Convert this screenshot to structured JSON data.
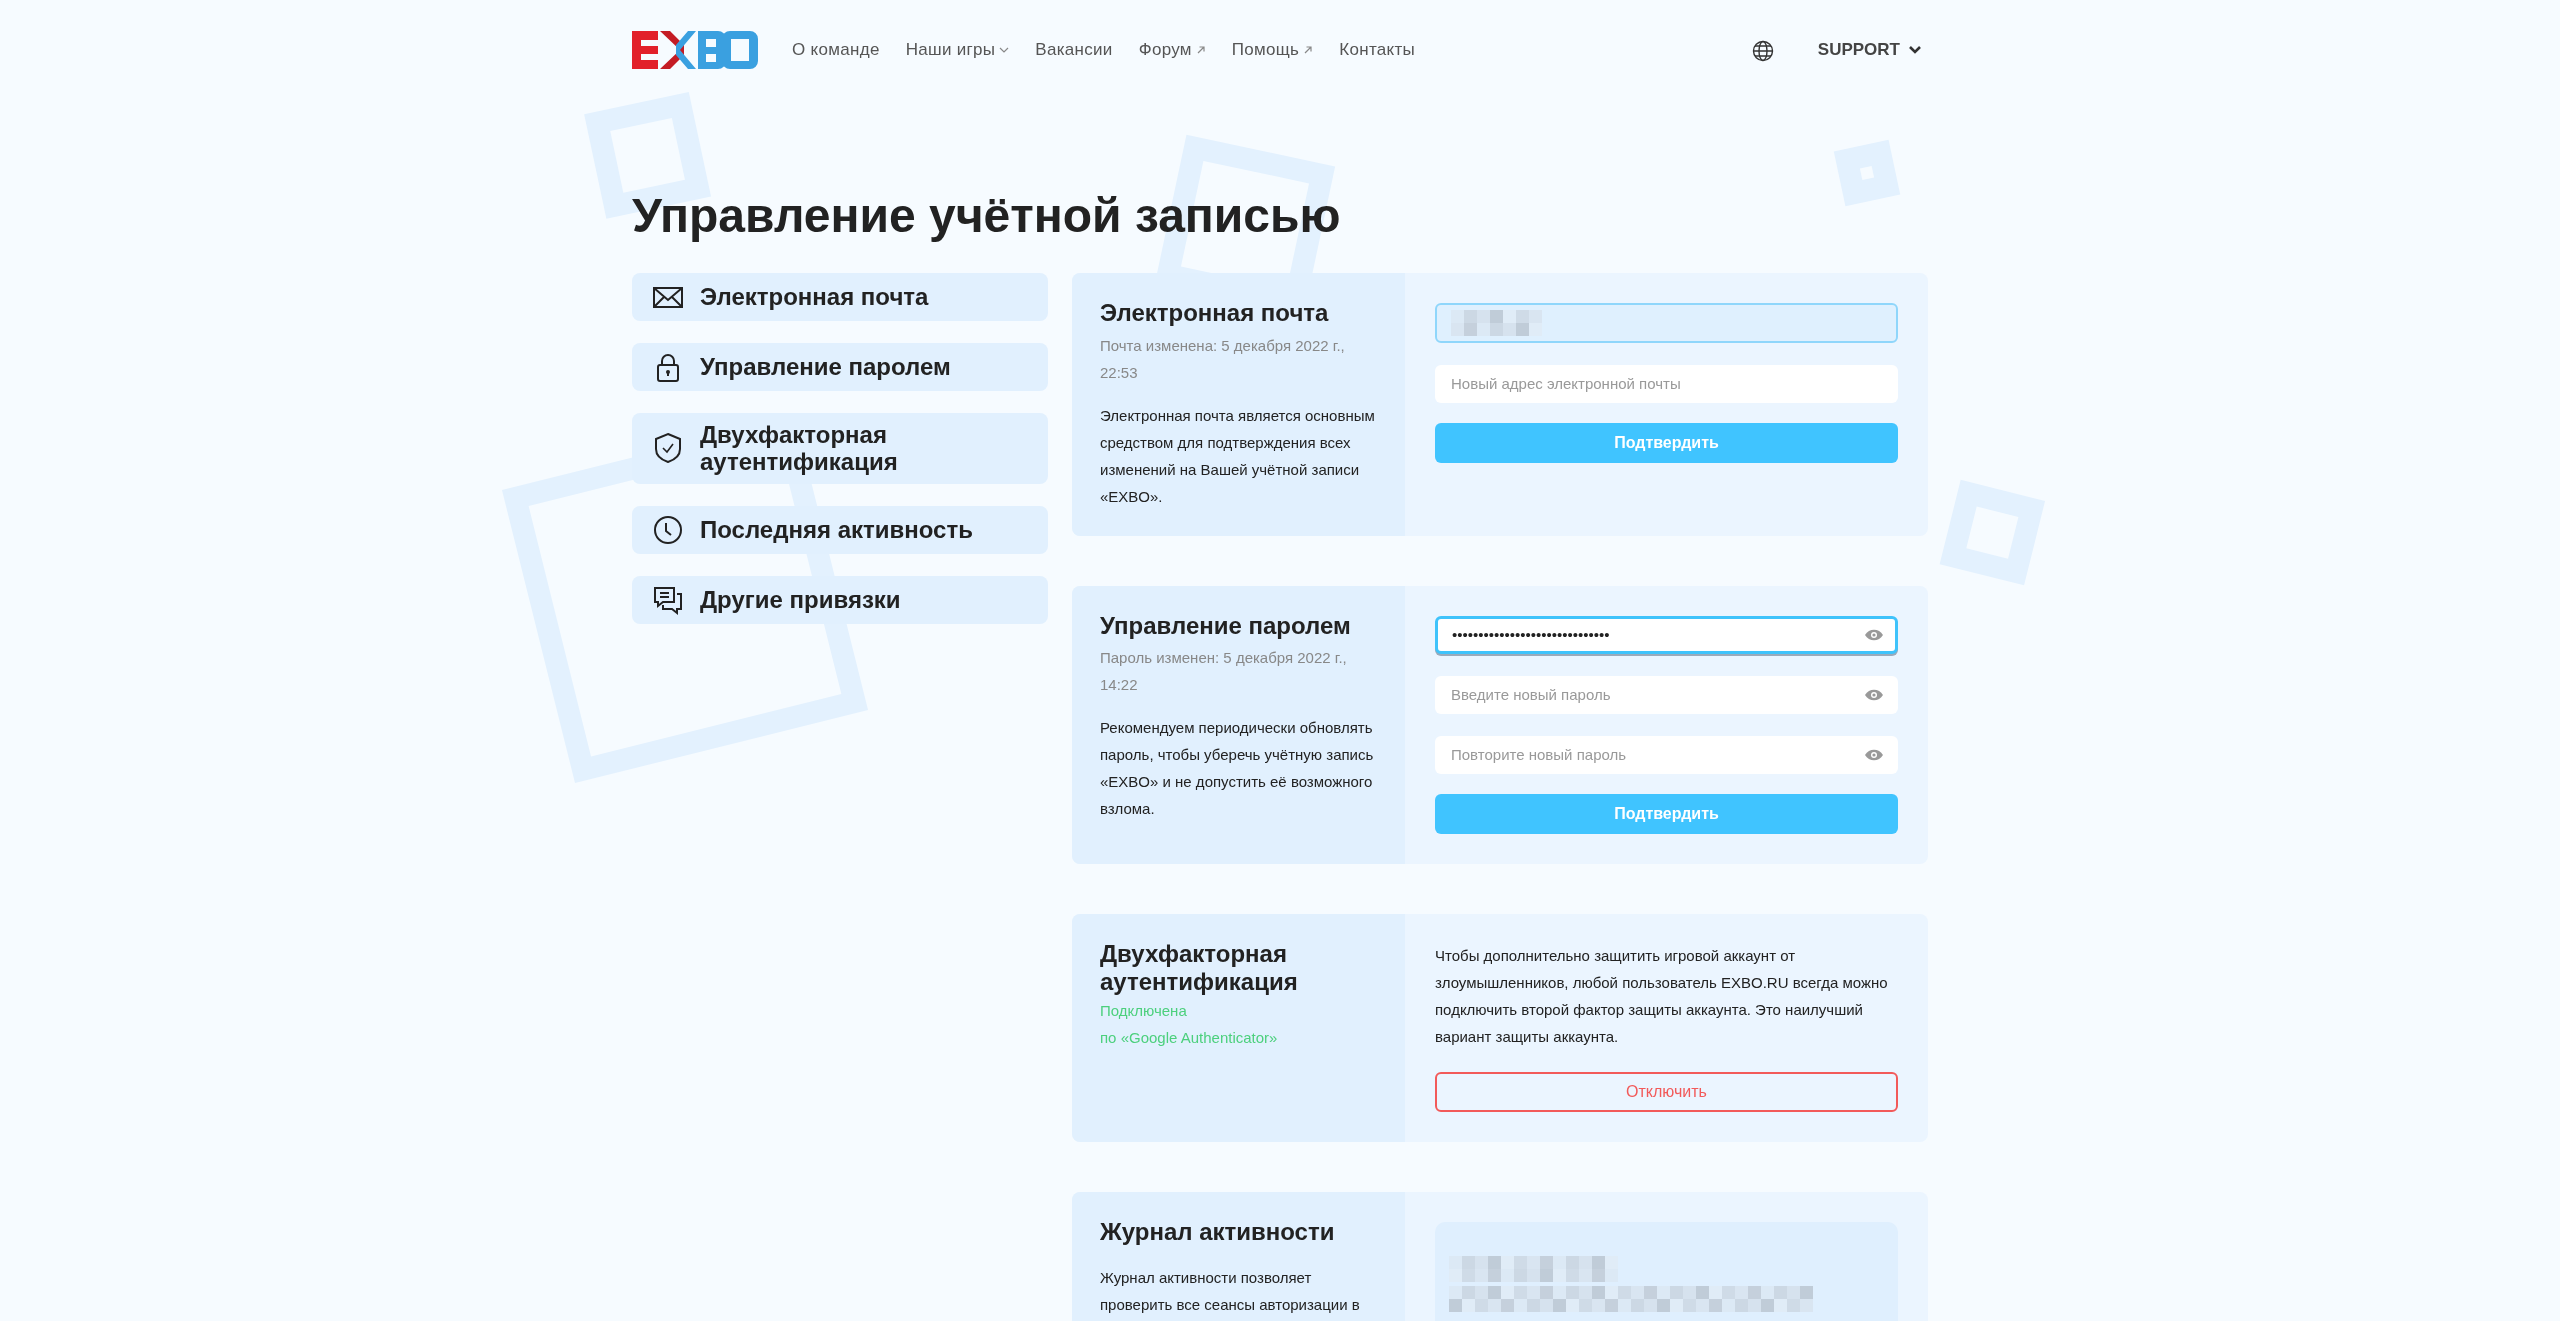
{
  "header": {
    "nav": [
      {
        "label": "О команде",
        "kind": "plain"
      },
      {
        "label": "Наши игры",
        "kind": "dropdown"
      },
      {
        "label": "Вакансии",
        "kind": "plain"
      },
      {
        "label": "Форум",
        "kind": "external"
      },
      {
        "label": "Помощь",
        "kind": "external"
      },
      {
        "label": "Контакты",
        "kind": "plain"
      }
    ],
    "account": "SUPPORT"
  },
  "title": "Управление учётной записью",
  "sidebar": [
    {
      "label": "Электронная почта",
      "kind": "mail"
    },
    {
      "label": "Управление паролем",
      "kind": "lock"
    },
    {
      "label": "Двухфакторная аутентификация",
      "kind": "shield"
    },
    {
      "label": "Последняя активность",
      "kind": "clock"
    },
    {
      "label": "Другие привязки",
      "kind": "chat"
    }
  ],
  "sections": [
    {
      "kind": "form",
      "title": "Электронная почта",
      "meta": "Почта изменена: 5 декабря 2022 г., 22:53",
      "description": "Электронная почта является основным средством для подтверждения всех изменений на Вашей учётной записи «EXBO».",
      "fields": [
        {
          "kind": "redacted",
          "focused": false
        },
        {
          "kind": "text",
          "placeholder": "Новый адрес электронной почты",
          "focused": false
        }
      ],
      "button": {
        "label": "Подтвердить",
        "kind": "primary"
      }
    },
    {
      "kind": "form",
      "title": "Управление паролем",
      "meta": "Пароль изменен: 5 декабря 2022 г., 14:22",
      "description": "Рекомендуем периодически обновлять пароль, чтобы уберечь учётную запись «EXBO» и не допустить её возможного взлома.",
      "fields": [
        {
          "kind": "password",
          "value": "••••••••••••••••••••••••••••••",
          "focused": true
        },
        {
          "kind": "password",
          "placeholder": "Введите новый пароль",
          "focused": false
        },
        {
          "kind": "password",
          "placeholder": "Повторите новый пароль",
          "focused": false
        }
      ],
      "button": {
        "label": "Подтвердить",
        "kind": "primary"
      }
    },
    {
      "kind": "info",
      "title": "Двухфакторная аутентификация",
      "status": [
        "Подключена",
        "по «Google Authenticator»"
      ],
      "description": "Чтобы дополнительно защитить игровой аккаунт от злоумышленников, любой пользователь EXBO.RU всегда можно подключить второй фактор защиты аккаунта. Это наилучший вариант защиты аккаунта.",
      "button": {
        "label": "Отключить",
        "kind": "danger"
      }
    },
    {
      "kind": "log",
      "title": "Журнал активности",
      "description": "Журнал активности позволяет проверить все сеансы авторизации в"
    }
  ]
}
